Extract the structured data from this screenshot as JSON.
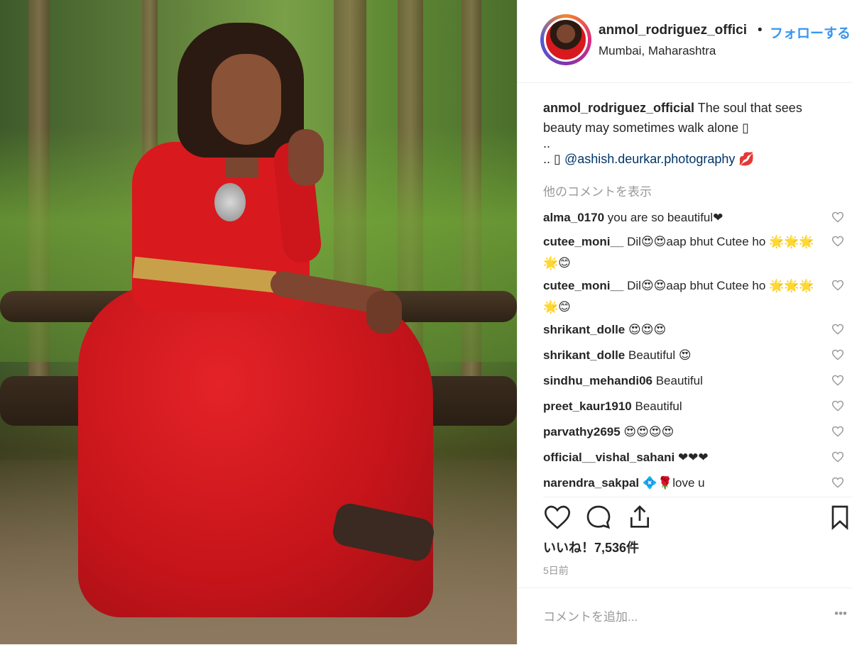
{
  "post": {
    "username": "anmol_rodriguez_offici",
    "separator": "•",
    "follow_label": "フォローする",
    "location": "Mumbai, Maharashtra"
  },
  "caption": {
    "username": "anmol_rodriguez_official",
    "text": "The soul that sees beauty may sometimes walk alone ▯",
    "line2": "..",
    "line3_prefix": ".. ▯",
    "mention": "@ashish.deurkar.photography",
    "mention_suffix": "💋"
  },
  "load_more_label": "他のコメントを表示",
  "comments": [
    {
      "user": "alma_0170",
      "text": "you are so beautiful❤"
    },
    {
      "user": "cutee_moni__",
      "text": "Dil😍😍aap bhut Cutee ho 🌟🌟🌟🌟😊"
    },
    {
      "user": "cutee_moni__",
      "text": "Dil😍😍aap bhut Cutee ho 🌟🌟🌟🌟😊"
    },
    {
      "user": "shrikant_dolle",
      "text": "😍😍😍"
    },
    {
      "user": "shrikant_dolle",
      "text": "Beautiful 😍"
    },
    {
      "user": "sindhu_mehandi06",
      "text": "Beautiful"
    },
    {
      "user": "preet_kaur1910",
      "text": "Beautiful"
    },
    {
      "user": "parvathy2695",
      "text": "😍😍😍😍"
    },
    {
      "user": "official__vishal_sahani",
      "text": "❤❤❤"
    },
    {
      "user": "narendra_sakpal",
      "text": "💠🌹love u"
    }
  ],
  "likes_label": "いいね！7,536件",
  "age_label": "5日前",
  "add_comment_placeholder": "コメントを追加...",
  "post_button_label": "•••",
  "icons": {
    "like": "heart-icon",
    "comment": "comment-icon",
    "share": "share-icon",
    "save": "bookmark-icon",
    "comment_like": "small-heart-icon"
  },
  "colors": {
    "link_blue": "#3897f0",
    "text": "#262626",
    "muted": "#999999",
    "dress_red": "#d8191e"
  }
}
